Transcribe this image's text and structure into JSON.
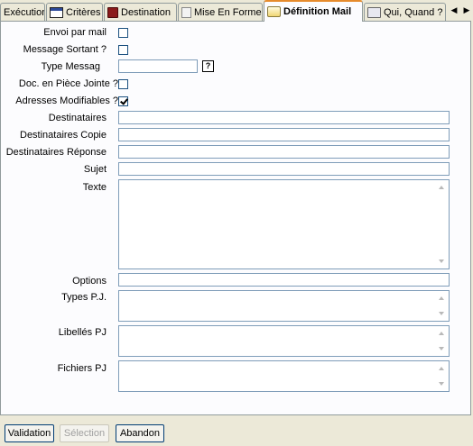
{
  "tabs": [
    {
      "label": "Exécution",
      "icon": "none"
    },
    {
      "label": "Critères",
      "icon": "window-icon"
    },
    {
      "label": "Destination",
      "icon": "book-icon"
    },
    {
      "label": "Mise En Forme",
      "icon": "document-icon"
    },
    {
      "label": "Définition Mail",
      "icon": "mail-icon",
      "active": true
    },
    {
      "label": "Qui, Quand ?",
      "icon": "card-icon"
    }
  ],
  "tab_scroll": {
    "left": "◀",
    "right": "▶"
  },
  "form": {
    "envoi_par_mail": {
      "label": "Envoi par mail",
      "checked": false
    },
    "message_sortant": {
      "label": "Message Sortant ?",
      "checked": false
    },
    "type_messag": {
      "label": "Type Messag",
      "value": "",
      "help": "?"
    },
    "doc_piece_jointe": {
      "label": "Doc. en Pièce Jointe ?",
      "checked": false
    },
    "adresses_modifiables": {
      "label": "Adresses Modifiables ?",
      "checked": true
    },
    "destinataires": {
      "label": "Destinataires",
      "value": ""
    },
    "destinataires_copie": {
      "label": "Destinataires Copie",
      "value": ""
    },
    "destinataires_reponse": {
      "label": "Destinataires Réponse",
      "value": ""
    },
    "sujet": {
      "label": "Sujet",
      "value": ""
    },
    "texte": {
      "label": "Texte",
      "value": ""
    },
    "options": {
      "label": "Options",
      "value": ""
    },
    "types_pj": {
      "label": "Types P.J.",
      "value": ""
    },
    "libelles_pj": {
      "label": "Libellés PJ",
      "value": ""
    },
    "fichiers_pj": {
      "label": "Fichiers PJ",
      "value": ""
    }
  },
  "buttons": {
    "validation": "Validation",
    "selection": "Sélection",
    "abandon": "Abandon"
  }
}
